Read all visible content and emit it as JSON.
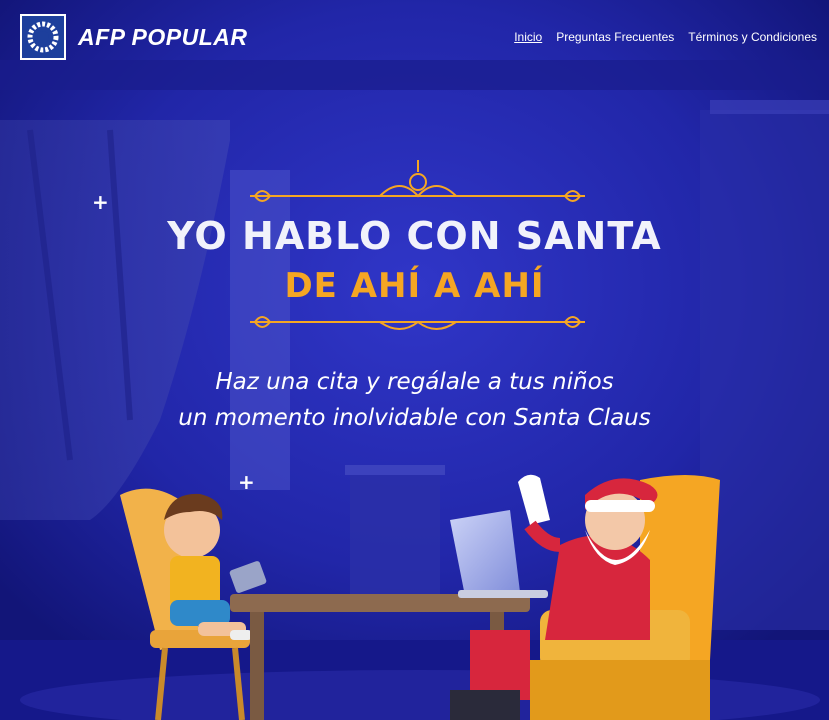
{
  "brand": {
    "name": "AFP POPULAR"
  },
  "nav": {
    "items": [
      {
        "label": "Inicio",
        "active": true
      },
      {
        "label": "Preguntas Frecuentes",
        "active": false
      },
      {
        "label": "Términos y Condiciones",
        "active": false
      }
    ]
  },
  "hero": {
    "title_line1": "YO HABLO CON SANTA",
    "title_line2": "DE AHÍ A AHÍ",
    "subtitle_line1": "Haz una cita y regálale a tus niños",
    "subtitle_line2": "un momento inolvidable con Santa Claus"
  },
  "colors": {
    "background": "#1c1f9e",
    "accent_gold": "#f5a623",
    "text_white": "#ffffff"
  }
}
